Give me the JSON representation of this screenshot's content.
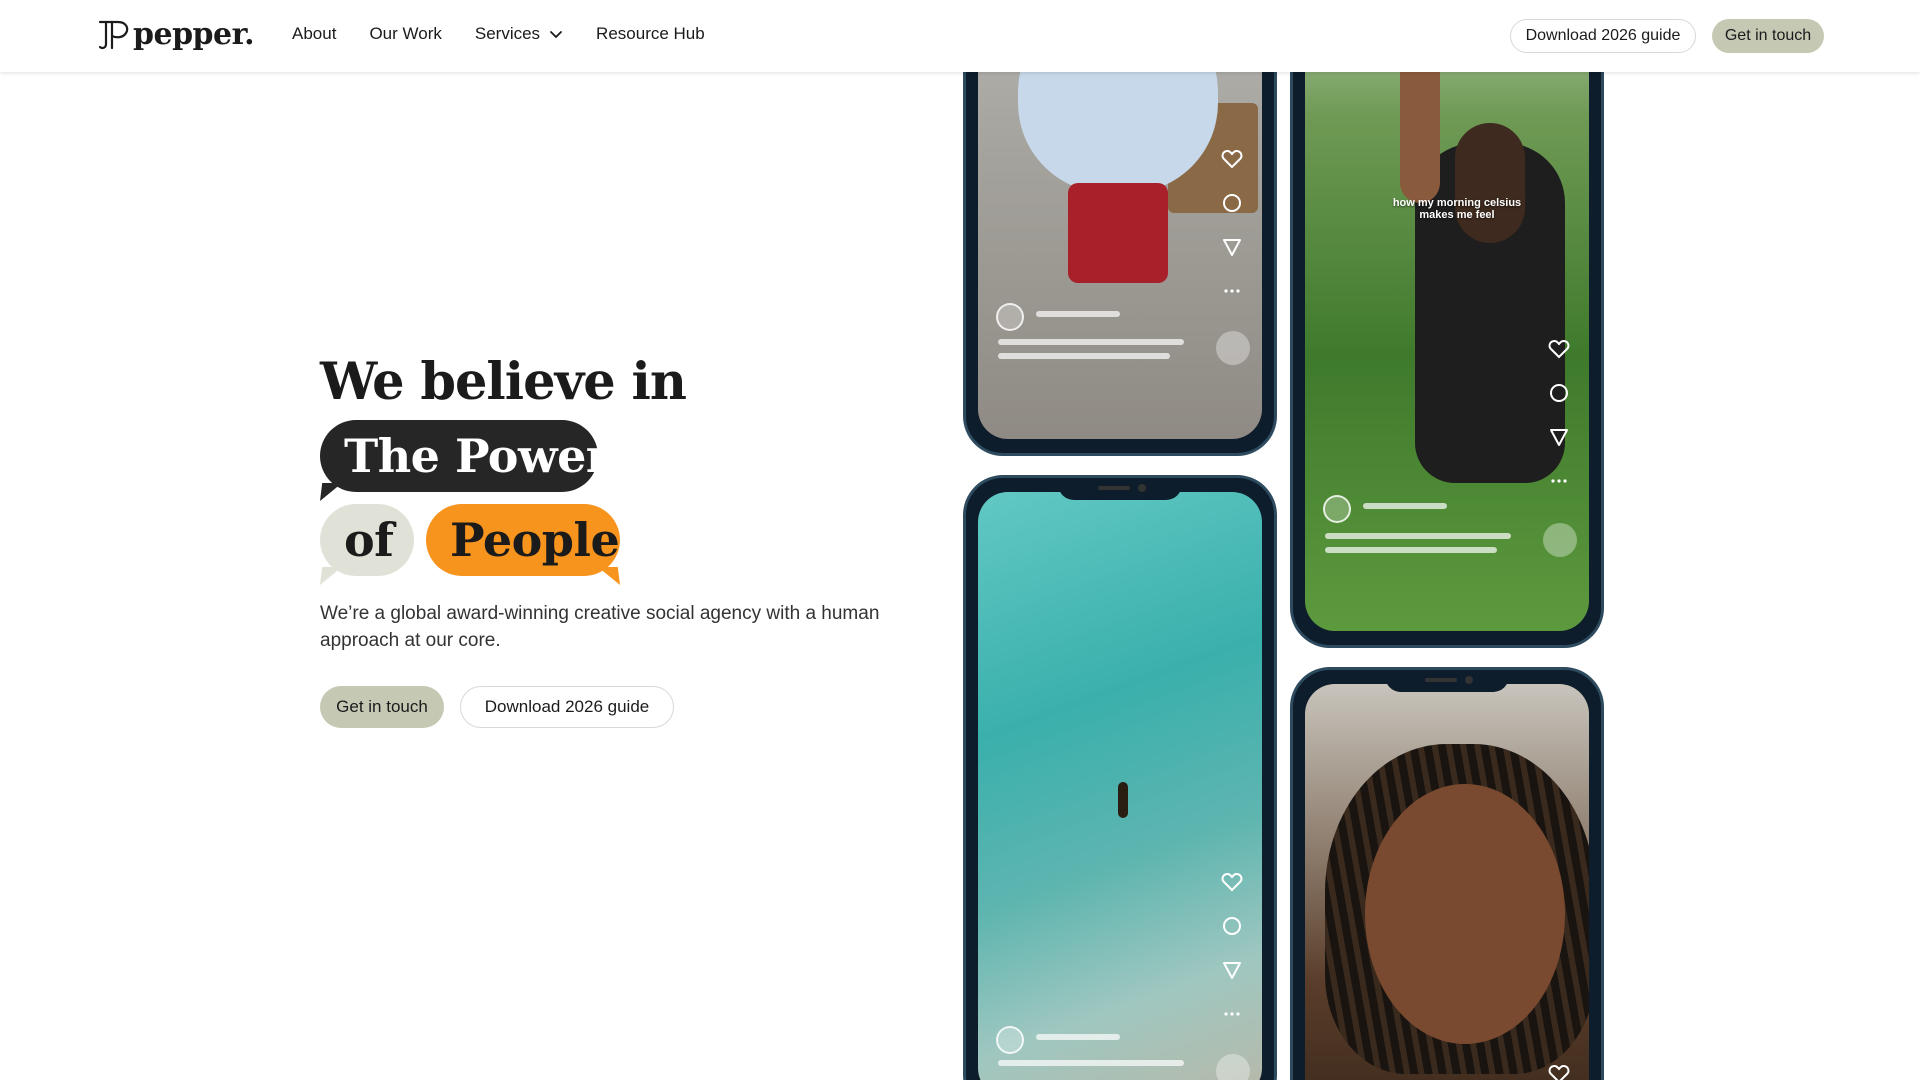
{
  "brand": {
    "name": "pepper."
  },
  "nav": {
    "items": [
      {
        "label": "About"
      },
      {
        "label": "Our Work"
      },
      {
        "label": "Services"
      },
      {
        "label": "Resource Hub"
      }
    ],
    "download_label": "Download 2026 guide",
    "contact_label": "Get in touch"
  },
  "hero": {
    "line1": "We believe in",
    "bubble_power": "The Power",
    "bubble_of": "of",
    "bubble_people": "People",
    "subtitle": "We’re a global award-winning creative social agency with a human approach at our core.",
    "cta_primary": "Get in touch",
    "cta_secondary": "Download 2026 guide"
  },
  "phones": {
    "p2_caption": "how my morning celsius makes me feel"
  },
  "colors": {
    "accent_orange": "#f7941d",
    "bubble_dark": "#262626",
    "bubble_light": "#e1e2d7",
    "button_sage": "#c5c9b4"
  },
  "icons": [
    "heart-icon",
    "comment-icon",
    "share-icon",
    "more-icon",
    "music-note-icon",
    "chevron-down-icon"
  ]
}
